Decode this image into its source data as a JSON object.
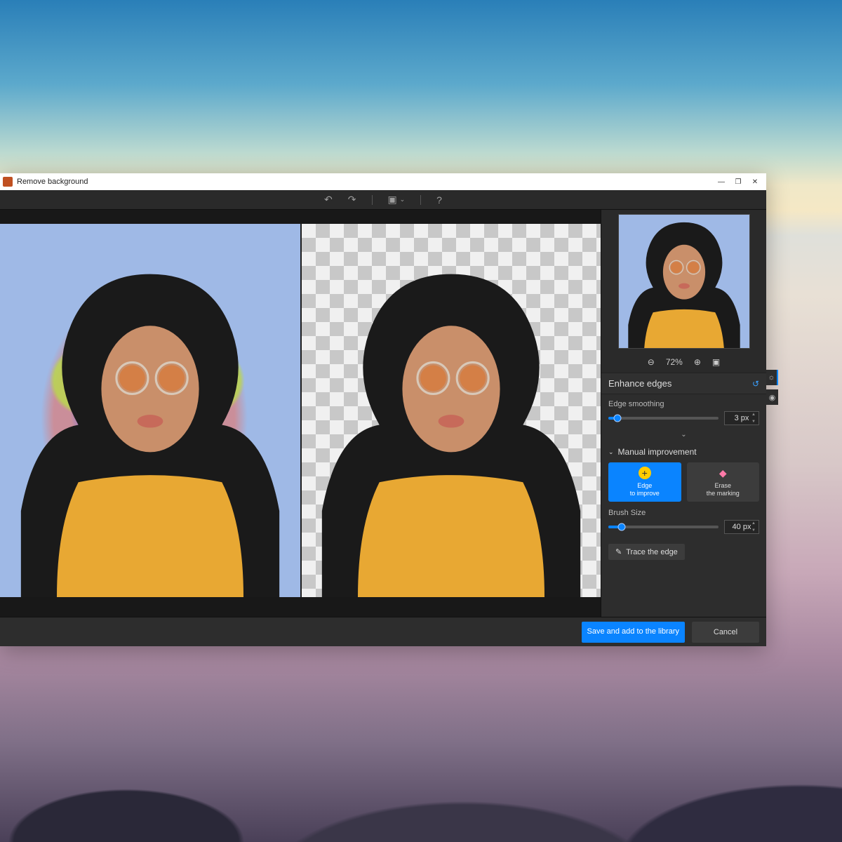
{
  "window": {
    "title": "Remove background",
    "controls": {
      "minimize": "—",
      "maximize": "❐",
      "close": "✕"
    }
  },
  "toolbar": {
    "undo": "↶",
    "redo": "↷",
    "view_mode": "▣",
    "view_dd": "⌄",
    "help": "?"
  },
  "preview": {
    "zoom_out": "⊖",
    "zoom_level": "72%",
    "zoom_in": "⊕",
    "fit": "▣"
  },
  "panel": {
    "enhance_title": "Enhance edges",
    "reset_icon": "↺",
    "edge_smoothing_label": "Edge smoothing",
    "edge_smoothing_value": "3 px",
    "edge_smoothing_pct": 8,
    "expand": "⌄",
    "manual_title": "Manual improvement",
    "edge_tool_label": "Edge\nto improve",
    "edge_tool_icon": "+",
    "erase_tool_label": "Erase\nthe marking",
    "erase_tool_icon": "◆",
    "brush_label": "Brush Size",
    "brush_value": "40 px",
    "brush_pct": 12,
    "trace_label": "Trace the edge",
    "trace_icon": "✎"
  },
  "footer": {
    "save": "Save and add to the library",
    "cancel": "Cancel"
  },
  "side_tabs": {
    "a": "☼",
    "b": "◉"
  },
  "colors": {
    "accent": "#0a84ff",
    "highlight": "#ffcc00",
    "erase": "#ff7aa8",
    "panel_bg": "#2d2d2d"
  }
}
